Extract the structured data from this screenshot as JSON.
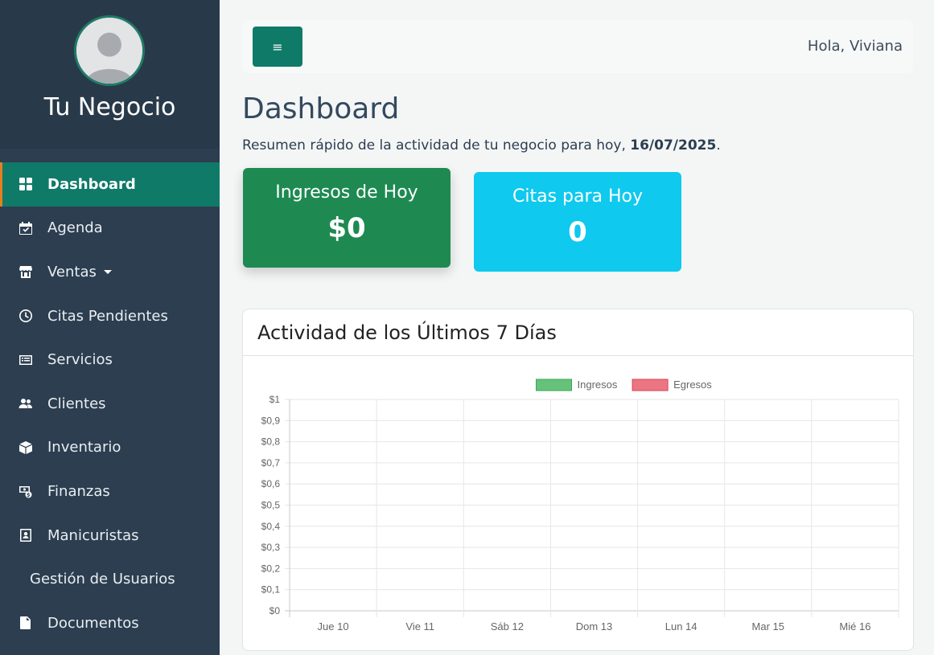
{
  "sidebar": {
    "brand": "Tu Negocio",
    "items": [
      {
        "label": "Dashboard",
        "icon": "grid-icon"
      },
      {
        "label": "Agenda",
        "icon": "calendar-check-icon"
      },
      {
        "label": "Ventas",
        "icon": "store-icon"
      },
      {
        "label": "Citas Pendientes",
        "icon": "clock-icon"
      },
      {
        "label": "Servicios",
        "icon": "list-card-icon"
      },
      {
        "label": "Clientes",
        "icon": "users-icon"
      },
      {
        "label": "Inventario",
        "icon": "box-icon"
      },
      {
        "label": "Finanzas",
        "icon": "money-icon"
      },
      {
        "label": "Manicuristas",
        "icon": "id-badge-icon"
      },
      {
        "label": "Gestión de Usuarios",
        "icon": ""
      },
      {
        "label": "Documentos",
        "icon": "document-icon"
      }
    ]
  },
  "topbar": {
    "menu_icon": "≡",
    "greeting": "Hola, Viviana"
  },
  "page": {
    "title": "Dashboard",
    "subtitle_prefix": "Resumen rápido de la actividad de tu negocio para hoy, ",
    "date": "16/07/2025",
    "subtitle_suffix": "."
  },
  "cards": {
    "ingresos": {
      "title": "Ingresos de Hoy",
      "value": "$0",
      "color": "#1e8a52"
    },
    "citas": {
      "title": "Citas para Hoy",
      "value": "0",
      "color": "#0fc9ee"
    }
  },
  "panel": {
    "title": "Actividad de los Últimos 7 Días"
  },
  "chart_data": {
    "type": "bar",
    "categories": [
      "Jue 10",
      "Vie 11",
      "Sáb 12",
      "Dom 13",
      "Lun 14",
      "Mar 15",
      "Mié 16"
    ],
    "series": [
      {
        "name": "Ingresos",
        "values": [
          0,
          0,
          0,
          0,
          0,
          0,
          0
        ],
        "color": "#66c27a",
        "border": "#3aa755"
      },
      {
        "name": "Egresos",
        "values": [
          0,
          0,
          0,
          0,
          0,
          0,
          0
        ],
        "color": "#ec7583",
        "border": "#d9434f"
      }
    ],
    "y_ticks": [
      "$0",
      "$0,1",
      "$0,2",
      "$0,3",
      "$0,4",
      "$0,5",
      "$0,6",
      "$0,7",
      "$0,8",
      "$0,9",
      "$1"
    ],
    "ylim": [
      0,
      1
    ],
    "grid": true,
    "legend": "top-center"
  }
}
